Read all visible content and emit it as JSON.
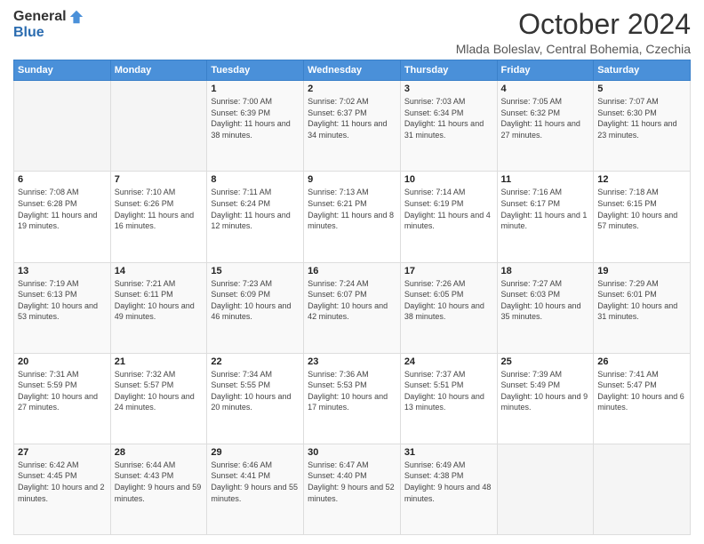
{
  "logo": {
    "general": "General",
    "blue": "Blue"
  },
  "title": "October 2024",
  "location": "Mlada Boleslav, Central Bohemia, Czechia",
  "weekdays": [
    "Sunday",
    "Monday",
    "Tuesday",
    "Wednesday",
    "Thursday",
    "Friday",
    "Saturday"
  ],
  "weeks": [
    [
      {
        "day": "",
        "info": ""
      },
      {
        "day": "",
        "info": ""
      },
      {
        "day": "1",
        "info": "Sunrise: 7:00 AM\nSunset: 6:39 PM\nDaylight: 11 hours and 38 minutes."
      },
      {
        "day": "2",
        "info": "Sunrise: 7:02 AM\nSunset: 6:37 PM\nDaylight: 11 hours and 34 minutes."
      },
      {
        "day": "3",
        "info": "Sunrise: 7:03 AM\nSunset: 6:34 PM\nDaylight: 11 hours and 31 minutes."
      },
      {
        "day": "4",
        "info": "Sunrise: 7:05 AM\nSunset: 6:32 PM\nDaylight: 11 hours and 27 minutes."
      },
      {
        "day": "5",
        "info": "Sunrise: 7:07 AM\nSunset: 6:30 PM\nDaylight: 11 hours and 23 minutes."
      }
    ],
    [
      {
        "day": "6",
        "info": "Sunrise: 7:08 AM\nSunset: 6:28 PM\nDaylight: 11 hours and 19 minutes."
      },
      {
        "day": "7",
        "info": "Sunrise: 7:10 AM\nSunset: 6:26 PM\nDaylight: 11 hours and 16 minutes."
      },
      {
        "day": "8",
        "info": "Sunrise: 7:11 AM\nSunset: 6:24 PM\nDaylight: 11 hours and 12 minutes."
      },
      {
        "day": "9",
        "info": "Sunrise: 7:13 AM\nSunset: 6:21 PM\nDaylight: 11 hours and 8 minutes."
      },
      {
        "day": "10",
        "info": "Sunrise: 7:14 AM\nSunset: 6:19 PM\nDaylight: 11 hours and 4 minutes."
      },
      {
        "day": "11",
        "info": "Sunrise: 7:16 AM\nSunset: 6:17 PM\nDaylight: 11 hours and 1 minute."
      },
      {
        "day": "12",
        "info": "Sunrise: 7:18 AM\nSunset: 6:15 PM\nDaylight: 10 hours and 57 minutes."
      }
    ],
    [
      {
        "day": "13",
        "info": "Sunrise: 7:19 AM\nSunset: 6:13 PM\nDaylight: 10 hours and 53 minutes."
      },
      {
        "day": "14",
        "info": "Sunrise: 7:21 AM\nSunset: 6:11 PM\nDaylight: 10 hours and 49 minutes."
      },
      {
        "day": "15",
        "info": "Sunrise: 7:23 AM\nSunset: 6:09 PM\nDaylight: 10 hours and 46 minutes."
      },
      {
        "day": "16",
        "info": "Sunrise: 7:24 AM\nSunset: 6:07 PM\nDaylight: 10 hours and 42 minutes."
      },
      {
        "day": "17",
        "info": "Sunrise: 7:26 AM\nSunset: 6:05 PM\nDaylight: 10 hours and 38 minutes."
      },
      {
        "day": "18",
        "info": "Sunrise: 7:27 AM\nSunset: 6:03 PM\nDaylight: 10 hours and 35 minutes."
      },
      {
        "day": "19",
        "info": "Sunrise: 7:29 AM\nSunset: 6:01 PM\nDaylight: 10 hours and 31 minutes."
      }
    ],
    [
      {
        "day": "20",
        "info": "Sunrise: 7:31 AM\nSunset: 5:59 PM\nDaylight: 10 hours and 27 minutes."
      },
      {
        "day": "21",
        "info": "Sunrise: 7:32 AM\nSunset: 5:57 PM\nDaylight: 10 hours and 24 minutes."
      },
      {
        "day": "22",
        "info": "Sunrise: 7:34 AM\nSunset: 5:55 PM\nDaylight: 10 hours and 20 minutes."
      },
      {
        "day": "23",
        "info": "Sunrise: 7:36 AM\nSunset: 5:53 PM\nDaylight: 10 hours and 17 minutes."
      },
      {
        "day": "24",
        "info": "Sunrise: 7:37 AM\nSunset: 5:51 PM\nDaylight: 10 hours and 13 minutes."
      },
      {
        "day": "25",
        "info": "Sunrise: 7:39 AM\nSunset: 5:49 PM\nDaylight: 10 hours and 9 minutes."
      },
      {
        "day": "26",
        "info": "Sunrise: 7:41 AM\nSunset: 5:47 PM\nDaylight: 10 hours and 6 minutes."
      }
    ],
    [
      {
        "day": "27",
        "info": "Sunrise: 6:42 AM\nSunset: 4:45 PM\nDaylight: 10 hours and 2 minutes."
      },
      {
        "day": "28",
        "info": "Sunrise: 6:44 AM\nSunset: 4:43 PM\nDaylight: 9 hours and 59 minutes."
      },
      {
        "day": "29",
        "info": "Sunrise: 6:46 AM\nSunset: 4:41 PM\nDaylight: 9 hours and 55 minutes."
      },
      {
        "day": "30",
        "info": "Sunrise: 6:47 AM\nSunset: 4:40 PM\nDaylight: 9 hours and 52 minutes."
      },
      {
        "day": "31",
        "info": "Sunrise: 6:49 AM\nSunset: 4:38 PM\nDaylight: 9 hours and 48 minutes."
      },
      {
        "day": "",
        "info": ""
      },
      {
        "day": "",
        "info": ""
      }
    ]
  ]
}
